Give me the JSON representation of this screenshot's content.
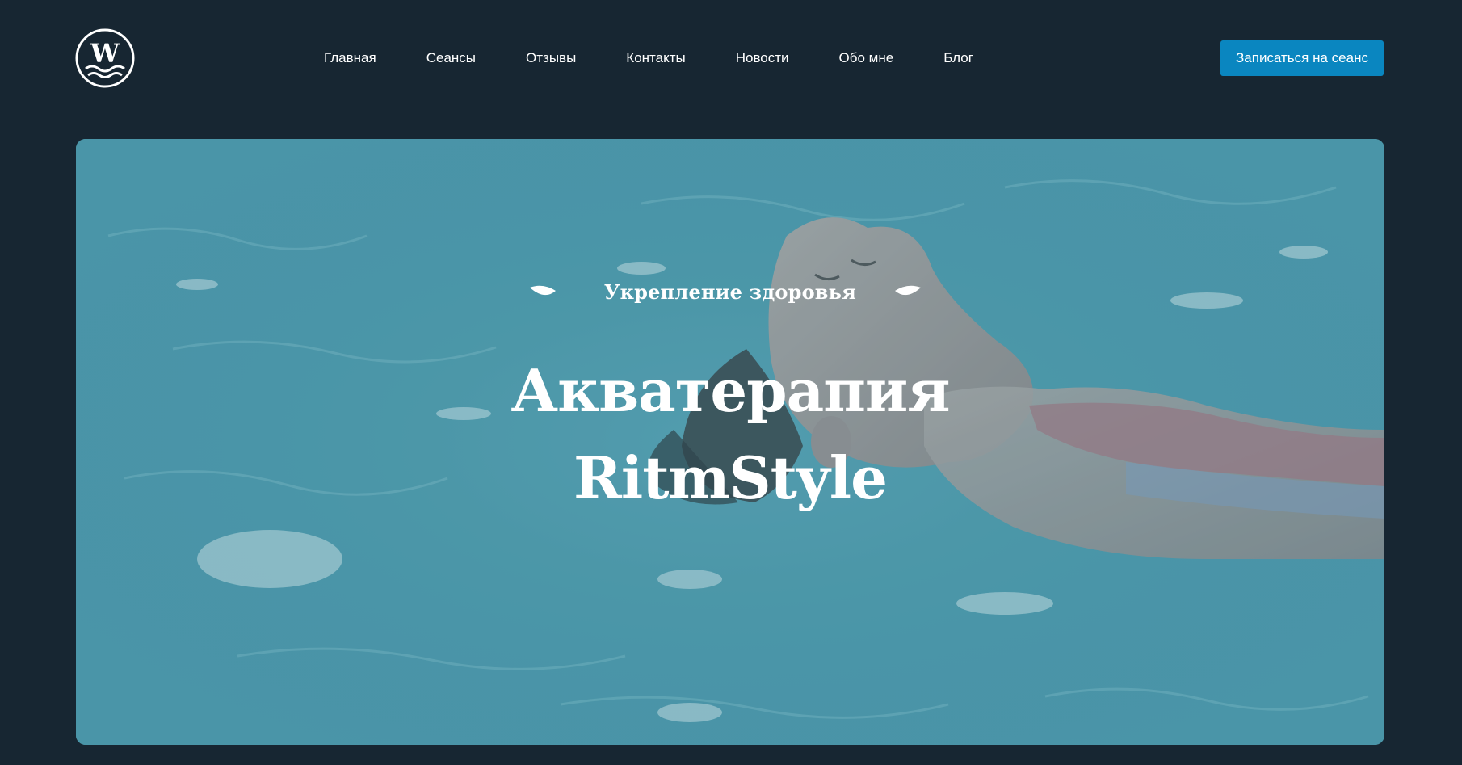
{
  "header": {
    "logo_icon": "wave-w-logo-icon",
    "nav": [
      {
        "label": "Главная"
      },
      {
        "label": "Сеансы"
      },
      {
        "label": "Отзывы"
      },
      {
        "label": "Контакты"
      },
      {
        "label": "Новости"
      },
      {
        "label": "Обо мне"
      },
      {
        "label": "Блог"
      }
    ],
    "cta_label": "Записаться на сеанс"
  },
  "hero": {
    "tagline": "Укрепление здоровья",
    "title_line1": "Акватерапия",
    "title_line2": "RitmStyle",
    "leaf_icon": "leaf-icon",
    "image_description": "woman-floating-in-pool-photo"
  },
  "colors": {
    "page_bg": "#172632",
    "accent": "#0a86c0",
    "text": "#ffffff",
    "water": "#5aa6b6"
  }
}
